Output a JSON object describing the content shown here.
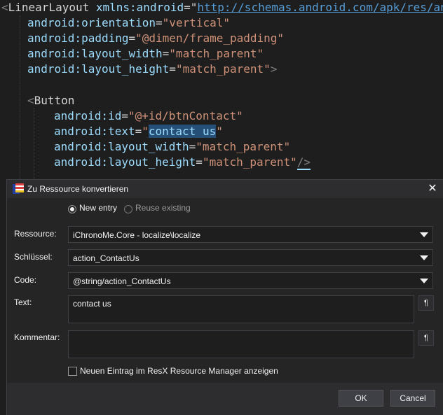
{
  "editor": {
    "line1": {
      "open": "<",
      "tag": "LinearLayout",
      "attr": "xmlns:android",
      "eq": "=\"",
      "url": "http://schemas.android.com/apk/res/andr"
    },
    "line2": {
      "attr": "android:orientation",
      "eq": "=",
      "val": "\"vertical\""
    },
    "line3": {
      "attr": "android:padding",
      "eq": "=",
      "val": "\"@dimen/frame_padding\""
    },
    "line4": {
      "attr": "android:layout_width",
      "eq": "=",
      "val": "\"match_parent\""
    },
    "line5": {
      "attr": "android:layout_height",
      "eq": "=",
      "val": "\"match_parent\"",
      "close": ">"
    },
    "line7": {
      "open": "<",
      "tag": "Button"
    },
    "line8": {
      "attr": "android:id",
      "eq": "=",
      "val": "\"@+id/btnContact\""
    },
    "line9": {
      "attr": "android:text",
      "eq": "=",
      "q1": "\"",
      "selected": "contact us",
      "q2": "\""
    },
    "line10": {
      "attr": "android:layout_width",
      "eq": "=",
      "val": "\"match_parent\""
    },
    "line11": {
      "attr": "android:layout_height",
      "eq": "=",
      "val": "\"match_parent\"",
      "close": "/>"
    }
  },
  "dialog": {
    "title": "Zu Ressource konvertieren",
    "close_glyph": "✕",
    "mode": {
      "new_entry": "New entry",
      "reuse_existing": "Reuse existing"
    },
    "fields": {
      "resource_label": "Ressource:",
      "resource_value": "iChronoMe.Core - localize\\localize",
      "key_label": "Schlüssel:",
      "key_value": "action_ContactUs",
      "code_label": "Code:",
      "code_value": "@string/action_ContactUs",
      "text_label": "Text:",
      "text_value": "contact us",
      "comment_label": "Kommentar:",
      "comment_value": ""
    },
    "pilcrow": "¶",
    "show_in_manager": "Neuen Eintrag im ResX Resource Manager anzeigen",
    "ok": "OK",
    "cancel": "Cancel"
  }
}
